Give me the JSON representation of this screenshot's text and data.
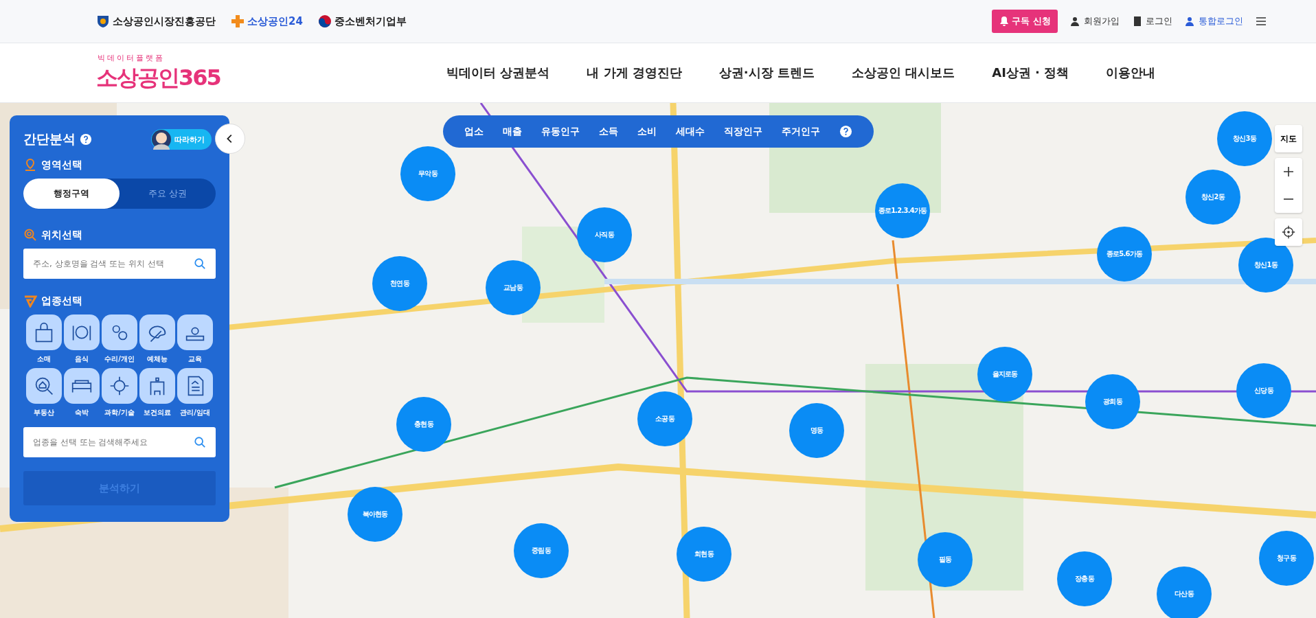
{
  "topbar": {
    "orgs": [
      "소상공인시장진흥공단",
      "소상공인24",
      "중소벤처기업부"
    ],
    "subscribe": "구독 신청",
    "links": [
      "회원가입",
      "로그인",
      "통합로그인"
    ]
  },
  "header": {
    "logo_small": "빅데이터플랫폼",
    "logo": "소상공인365",
    "nav": [
      "빅데이터 상권분석",
      "내 가게 경영진단",
      "상권·시장 트렌드",
      "소상공인 대시보드",
      "AI상권 · 정책",
      "이용안내"
    ]
  },
  "panel": {
    "title": "간단분석",
    "follow": "따라하기",
    "area_title": "영역선택",
    "area_tabs": [
      {
        "label": "행정구역",
        "selected": true
      },
      {
        "label": "주요 상권",
        "selected": false
      }
    ],
    "location_title": "위치선택",
    "location_search": {
      "placeholder": "주소, 상호명을 검색 또는 위치 선택"
    },
    "industry_title": "업종선택",
    "industries": [
      "소매",
      "음식",
      "수리/개인",
      "예체능",
      "교육",
      "부동산",
      "숙박",
      "과학/기술",
      "보건의료",
      "관리/임대"
    ],
    "industry_search": {
      "placeholder": "업종을 선택 또는 검색해주세요"
    },
    "analyze": {
      "label": "분석하기",
      "disabled": true
    }
  },
  "categories": [
    "업소",
    "매출",
    "유동인구",
    "소득",
    "소비",
    "세대수",
    "직장인구",
    "주거인구"
  ],
  "map_controls": {
    "map_type": "지도"
  },
  "districts": [
    "무악동",
    "사직동",
    "종로1.2.3.4가동",
    "창신3동",
    "창신2동",
    "종로5.6가동",
    "창신1동",
    "천연동",
    "교남동",
    "을지로동",
    "광희동",
    "신당동",
    "충현동",
    "소공동",
    "명동",
    "북아현동",
    "중림동",
    "회현동",
    "필동",
    "장충동",
    "다산동",
    "청구동"
  ]
}
